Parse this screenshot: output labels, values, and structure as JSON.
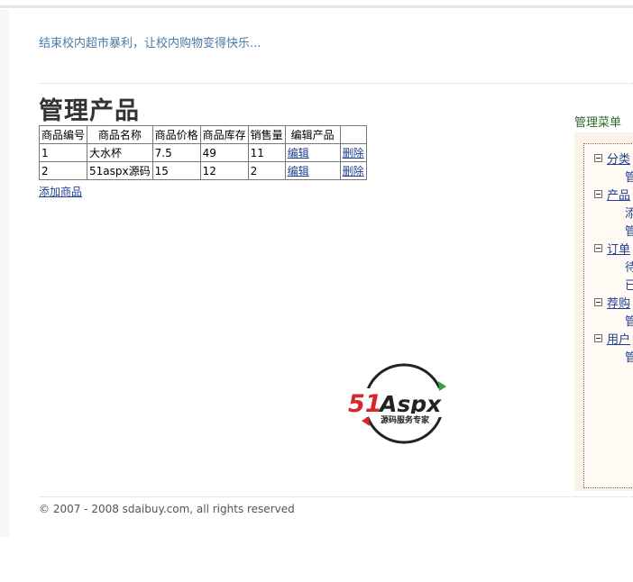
{
  "header": {
    "tagline": "结束校内超市暴利，让校内购物变得快乐..."
  },
  "main": {
    "title": "管理产品",
    "table": {
      "columns": [
        "商品编号",
        "商品名称",
        "商品价格",
        "商品库存",
        "销售量",
        "编辑产品",
        ""
      ],
      "rows": [
        {
          "id": "1",
          "name": "大水杯",
          "price": "7.5",
          "stock": "49",
          "sales": "11",
          "edit": "编辑",
          "delete": "删除"
        },
        {
          "id": "2",
          "name": "51aspx源码",
          "price": "15",
          "stock": "12",
          "sales": "2",
          "edit": "编辑",
          "delete": "删除"
        }
      ]
    },
    "add_link": "添加商品"
  },
  "logo": {
    "brand_51": "51",
    "brand_aspx": "Aspx",
    "slogan": "源码服务专家",
    "colors": {
      "red": "#d8262b",
      "green": "#3aa03a",
      "dark": "#222222"
    }
  },
  "sidebar": {
    "title": "管理菜单",
    "groups": [
      {
        "label": "分类",
        "subs": [
          "管"
        ]
      },
      {
        "label": "产品",
        "subs": [
          "添",
          "管"
        ]
      },
      {
        "label": "订单",
        "subs": [
          "待",
          "已"
        ]
      },
      {
        "label": "荐购",
        "subs": [
          "管"
        ]
      },
      {
        "label": "用户",
        "subs": [
          "管"
        ]
      }
    ]
  },
  "footer": {
    "copyright": "© 2007 - 2008 sdaibuy.com, all rights reserved"
  },
  "colors": {
    "link": "#1f3f8f",
    "tagline": "#4a7aa6",
    "menu_title": "#2b6a2b",
    "menu_bg": "#fbf2e8"
  }
}
